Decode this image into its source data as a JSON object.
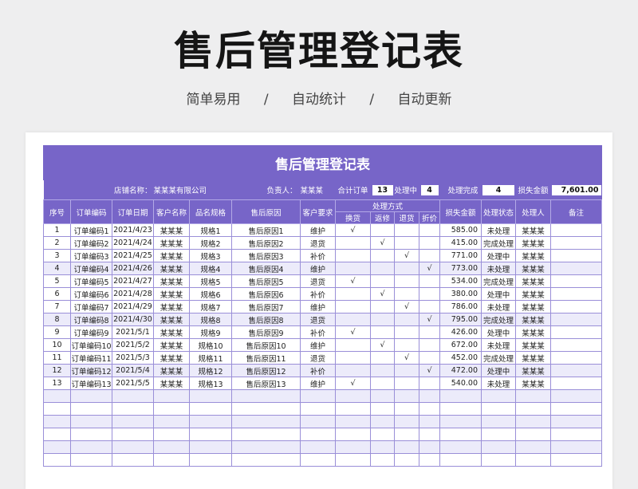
{
  "hero": {
    "title": "售后管理登记表",
    "tags": [
      "简单易用",
      "/",
      "自动统计",
      "/",
      "自动更新"
    ]
  },
  "sheet": {
    "title": "售后管理登记表",
    "info": {
      "store_label": "店铺名称：",
      "store_value": "某某某有限公司",
      "owner_label": "负责人：",
      "owner_value": "某某某",
      "total_label": "合计订单",
      "total_value": "13",
      "processing_label": "处理中",
      "processing_value": "4",
      "done_label": "处理完成",
      "done_value": "4",
      "loss_label": "损失金额",
      "loss_value": "7,601.00"
    },
    "headers": {
      "seq": "序号",
      "order_code": "订单编码",
      "order_date": "订单日期",
      "customer": "客户名称",
      "spec": "品名规格",
      "reason": "售后原因",
      "request": "客户要求",
      "method": "处理方式",
      "exchange": "换货",
      "repair": "返修",
      "refund": "退货",
      "discount": "折价",
      "loss": "损失金额",
      "status": "处理状态",
      "handler": "处理人",
      "note": "备注"
    },
    "rows": [
      {
        "seq": "1",
        "code": "订单编码1",
        "date": "2021/4/23",
        "customer": "某某某",
        "spec": "规格1",
        "reason": "售后原因1",
        "request": "维护",
        "exchange": "√",
        "repair": "",
        "refund": "",
        "discount": "",
        "loss": "585.00",
        "status": "未处理",
        "handler": "某某某",
        "note": ""
      },
      {
        "seq": "2",
        "code": "订单编码2",
        "date": "2021/4/24",
        "customer": "某某某",
        "spec": "规格2",
        "reason": "售后原因2",
        "request": "退货",
        "exchange": "",
        "repair": "√",
        "refund": "",
        "discount": "",
        "loss": "415.00",
        "status": "完成处理",
        "handler": "某某某",
        "note": ""
      },
      {
        "seq": "3",
        "code": "订单编码3",
        "date": "2021/4/25",
        "customer": "某某某",
        "spec": "规格3",
        "reason": "售后原因3",
        "request": "补价",
        "exchange": "",
        "repair": "",
        "refund": "√",
        "discount": "",
        "loss": "771.00",
        "status": "处理中",
        "handler": "某某某",
        "note": ""
      },
      {
        "seq": "4",
        "code": "订单编码4",
        "date": "2021/4/26",
        "customer": "某某某",
        "spec": "规格4",
        "reason": "售后原因4",
        "request": "维护",
        "exchange": "",
        "repair": "",
        "refund": "",
        "discount": "√",
        "loss": "773.00",
        "status": "未处理",
        "handler": "某某某",
        "note": ""
      },
      {
        "seq": "5",
        "code": "订单编码5",
        "date": "2021/4/27",
        "customer": "某某某",
        "spec": "规格5",
        "reason": "售后原因5",
        "request": "退货",
        "exchange": "√",
        "repair": "",
        "refund": "",
        "discount": "",
        "loss": "534.00",
        "status": "完成处理",
        "handler": "某某某",
        "note": ""
      },
      {
        "seq": "6",
        "code": "订单编码6",
        "date": "2021/4/28",
        "customer": "某某某",
        "spec": "规格6",
        "reason": "售后原因6",
        "request": "补价",
        "exchange": "",
        "repair": "√",
        "refund": "",
        "discount": "",
        "loss": "380.00",
        "status": "处理中",
        "handler": "某某某",
        "note": ""
      },
      {
        "seq": "7",
        "code": "订单编码7",
        "date": "2021/4/29",
        "customer": "某某某",
        "spec": "规格7",
        "reason": "售后原因7",
        "request": "维护",
        "exchange": "",
        "repair": "",
        "refund": "√",
        "discount": "",
        "loss": "786.00",
        "status": "未处理",
        "handler": "某某某",
        "note": ""
      },
      {
        "seq": "8",
        "code": "订单编码8",
        "date": "2021/4/30",
        "customer": "某某某",
        "spec": "规格8",
        "reason": "售后原因8",
        "request": "退货",
        "exchange": "",
        "repair": "",
        "refund": "",
        "discount": "√",
        "loss": "795.00",
        "status": "完成处理",
        "handler": "某某某",
        "note": ""
      },
      {
        "seq": "9",
        "code": "订单编码9",
        "date": "2021/5/1",
        "customer": "某某某",
        "spec": "规格9",
        "reason": "售后原因9",
        "request": "补价",
        "exchange": "√",
        "repair": "",
        "refund": "",
        "discount": "",
        "loss": "426.00",
        "status": "处理中",
        "handler": "某某某",
        "note": ""
      },
      {
        "seq": "10",
        "code": "订单编码10",
        "date": "2021/5/2",
        "customer": "某某某",
        "spec": "规格10",
        "reason": "售后原因10",
        "request": "维护",
        "exchange": "",
        "repair": "√",
        "refund": "",
        "discount": "",
        "loss": "672.00",
        "status": "未处理",
        "handler": "某某某",
        "note": ""
      },
      {
        "seq": "11",
        "code": "订单编码11",
        "date": "2021/5/3",
        "customer": "某某某",
        "spec": "规格11",
        "reason": "售后原因11",
        "request": "退货",
        "exchange": "",
        "repair": "",
        "refund": "√",
        "discount": "",
        "loss": "452.00",
        "status": "完成处理",
        "handler": "某某某",
        "note": ""
      },
      {
        "seq": "12",
        "code": "订单编码12",
        "date": "2021/5/4",
        "customer": "某某某",
        "spec": "规格12",
        "reason": "售后原因12",
        "request": "补价",
        "exchange": "",
        "repair": "",
        "refund": "",
        "discount": "√",
        "loss": "472.00",
        "status": "处理中",
        "handler": "某某某",
        "note": ""
      },
      {
        "seq": "13",
        "code": "订单编码13",
        "date": "2021/5/5",
        "customer": "某某某",
        "spec": "规格13",
        "reason": "售后原因13",
        "request": "维护",
        "exchange": "√",
        "repair": "",
        "refund": "",
        "discount": "",
        "loss": "540.00",
        "status": "未处理",
        "handler": "某某某",
        "note": ""
      }
    ],
    "empty_rows": 6
  },
  "colors": {
    "accent": "#7765c8",
    "alt_row": "#ecebfa",
    "grid_line": "#9a8fd8"
  }
}
